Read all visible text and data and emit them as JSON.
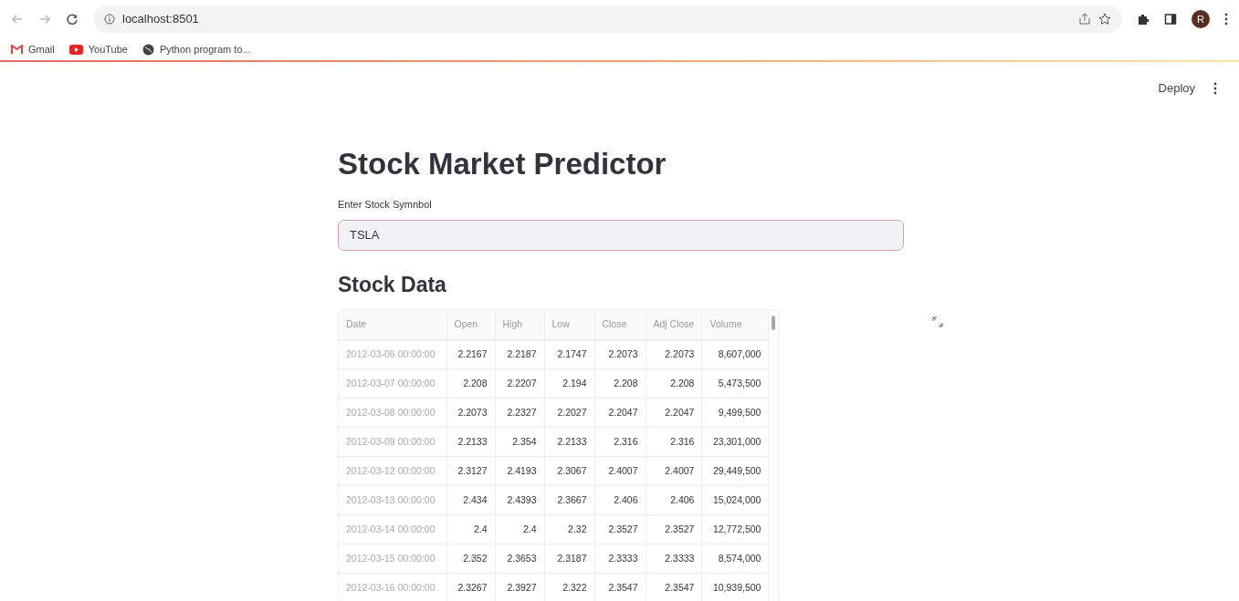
{
  "browser": {
    "url": "localhost:8501",
    "bookmarks": [
      {
        "kind": "gmail",
        "label": "Gmail"
      },
      {
        "kind": "youtube",
        "label": "YouTube"
      },
      {
        "kind": "globe",
        "label": "Python program to..."
      }
    ],
    "profile_initial": "R"
  },
  "app_header": {
    "deploy": "Deploy"
  },
  "title": "Stock Market Predictor",
  "symbol_input": {
    "label": "Enter Stock Symnbol",
    "value": "TSLA"
  },
  "section_title": "Stock Data",
  "table": {
    "columns": [
      "Date",
      "Open",
      "High",
      "Low",
      "Close",
      "Adj Close",
      "Volume"
    ],
    "rows": [
      [
        "2012-03-06 00:00:00",
        "2.2167",
        "2.2187",
        "2.1747",
        "2.2073",
        "2.2073",
        "8,607,000"
      ],
      [
        "2012-03-07 00:00:00",
        "2.208",
        "2.2207",
        "2.194",
        "2.208",
        "2.208",
        "5,473,500"
      ],
      [
        "2012-03-08 00:00:00",
        "2.2073",
        "2.2327",
        "2.2027",
        "2.2047",
        "2.2047",
        "9,499,500"
      ],
      [
        "2012-03-09 00:00:00",
        "2.2133",
        "2.354",
        "2.2133",
        "2.316",
        "2.316",
        "23,301,000"
      ],
      [
        "2012-03-12 00:00:00",
        "2.3127",
        "2.4193",
        "2.3067",
        "2.4007",
        "2.4007",
        "29,449,500"
      ],
      [
        "2012-03-13 00:00:00",
        "2.434",
        "2.4393",
        "2.3667",
        "2.406",
        "2.406",
        "15,024,000"
      ],
      [
        "2012-03-14 00:00:00",
        "2.4",
        "2.4",
        "2.32",
        "2.3527",
        "2.3527",
        "12,772,500"
      ],
      [
        "2012-03-15 00:00:00",
        "2.352",
        "2.3653",
        "2.3187",
        "2.3333",
        "2.3333",
        "8,574,000"
      ],
      [
        "2012-03-16 00:00:00",
        "2.3267",
        "2.3927",
        "2.322",
        "2.3547",
        "2.3547",
        "10,939,500"
      ]
    ]
  }
}
